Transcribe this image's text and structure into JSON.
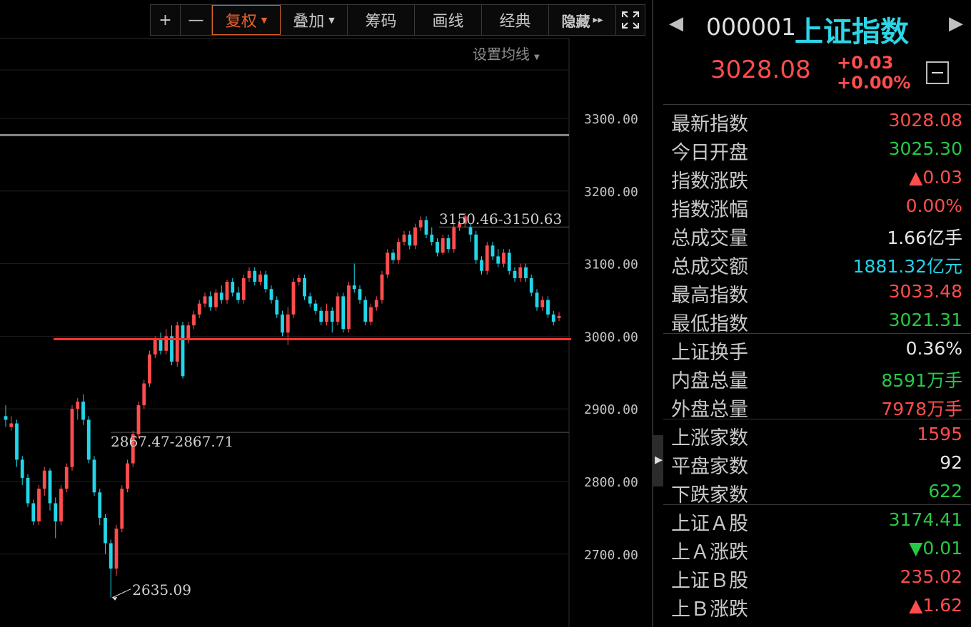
{
  "toolbar": {
    "zoom_in": "+",
    "zoom_out": "—",
    "rights": "复权",
    "overlay": "叠加",
    "chips": "筹码",
    "draw": "画线",
    "classic": "经典",
    "hide": "隐藏",
    "hide_arrows": "▸▸",
    "fullscreen_icon": "fullscreen-icon"
  },
  "ma_setting": "设置均线",
  "colors": {
    "up": "#ff4d4d",
    "down": "#21d6e8",
    "support": "#ff3333",
    "accent": "#e3622d",
    "name": "#2bd6e6"
  },
  "quote": {
    "code": "000001",
    "name": "上证指数",
    "price": "3028.08",
    "change": "+0.03",
    "change_pct": "+0.00%"
  },
  "stats": [
    {
      "label": "最新指数",
      "value": "3028.08",
      "color": "red"
    },
    {
      "label": "今日开盘",
      "value": "3025.30",
      "color": "green"
    },
    {
      "label": "指数涨跌",
      "value": "▲0.03",
      "color": "red"
    },
    {
      "label": "指数涨幅",
      "value": "0.00%",
      "color": "red"
    },
    {
      "label": "总成交量",
      "value": "1.66亿手",
      "color": "white"
    },
    {
      "label": "总成交额",
      "value": "1881.32亿元",
      "color": "cyan"
    },
    {
      "label": "最高指数",
      "value": "3033.48",
      "color": "red"
    },
    {
      "label": "最低指数",
      "value": "3021.31",
      "color": "green"
    },
    {
      "label": "上证换手",
      "value": "0.36%",
      "color": "white"
    },
    {
      "label": "内盘总量",
      "value": "8591万手",
      "color": "green"
    },
    {
      "label": "外盘总量",
      "value": "7978万手",
      "color": "red"
    },
    {
      "label": "上涨家数",
      "value": "1595",
      "color": "red"
    },
    {
      "label": "平盘家数",
      "value": "92",
      "color": "white"
    },
    {
      "label": "下跌家数",
      "value": "622",
      "color": "green"
    },
    {
      "label": "上证Ａ股",
      "value": "3174.41",
      "color": "green"
    },
    {
      "label": "上Ａ涨跌",
      "value": "▼0.01",
      "color": "green"
    },
    {
      "label": "上证Ｂ股",
      "value": "235.02",
      "color": "red"
    },
    {
      "label": "上Ｂ涨跌",
      "value": "▲1.62",
      "color": "red"
    }
  ],
  "chart_data": {
    "type": "candlestick",
    "y_ticks": [
      "3300.00",
      "3200.00",
      "3100.00",
      "3000.00",
      "2900.00",
      "2800.00",
      "2700.00"
    ],
    "ylim": [
      2625,
      3385
    ],
    "annotations": {
      "low": "2635.09",
      "range_low": "2867.47-2867.71",
      "range_high": "3150.46-3150.63"
    },
    "reference_lines": {
      "support": 2996,
      "grey_upper": 3277,
      "grey_lower": 2867.6,
      "grey_high": 3150.5
    },
    "candles": [
      [
        2890,
        2885,
        2905,
        2875
      ],
      [
        2875,
        2880,
        2890,
        2870
      ],
      [
        2880,
        2830,
        2885,
        2820
      ],
      [
        2830,
        2805,
        2835,
        2795
      ],
      [
        2805,
        2770,
        2810,
        2765
      ],
      [
        2770,
        2745,
        2775,
        2740
      ],
      [
        2745,
        2790,
        2795,
        2740
      ],
      [
        2790,
        2815,
        2820,
        2780
      ],
      [
        2815,
        2770,
        2818,
        2760
      ],
      [
        2770,
        2745,
        2778,
        2722
      ],
      [
        2745,
        2790,
        2795,
        2740
      ],
      [
        2790,
        2820,
        2825,
        2785
      ],
      [
        2820,
        2900,
        2905,
        2815
      ],
      [
        2900,
        2910,
        2915,
        2885
      ],
      [
        2910,
        2885,
        2920,
        2878
      ],
      [
        2885,
        2830,
        2890,
        2825
      ],
      [
        2830,
        2785,
        2835,
        2780
      ],
      [
        2785,
        2750,
        2790,
        2740
      ],
      [
        2750,
        2715,
        2755,
        2700
      ],
      [
        2715,
        2680,
        2720,
        2640
      ],
      [
        2680,
        2735,
        2740,
        2670
      ],
      [
        2735,
        2790,
        2795,
        2730
      ],
      [
        2790,
        2825,
        2830,
        2785
      ],
      [
        2825,
        2865,
        2870,
        2820
      ],
      [
        2865,
        2905,
        2910,
        2860
      ],
      [
        2905,
        2935,
        2940,
        2900
      ],
      [
        2935,
        2975,
        2980,
        2930
      ],
      [
        2975,
        2995,
        3000,
        2970
      ],
      [
        2995,
        2980,
        3005,
        2975
      ],
      [
        2980,
        3000,
        3010,
        2975
      ],
      [
        3000,
        2965,
        3015,
        2960
      ],
      [
        2965,
        3015,
        3020,
        2958
      ],
      [
        3015,
        2945,
        3020,
        2942
      ],
      [
        2995,
        3015,
        3020,
        2990
      ],
      [
        3015,
        3030,
        3035,
        3010
      ],
      [
        3030,
        3045,
        3050,
        3025
      ],
      [
        3045,
        3055,
        3060,
        3040
      ],
      [
        3055,
        3040,
        3062,
        3035
      ],
      [
        3040,
        3060,
        3065,
        3035
      ],
      [
        3060,
        3050,
        3070,
        3045
      ],
      [
        3050,
        3075,
        3078,
        3045
      ],
      [
        3075,
        3060,
        3080,
        3055
      ],
      [
        3060,
        3050,
        3068,
        3045
      ],
      [
        3050,
        3080,
        3085,
        3045
      ],
      [
        3080,
        3090,
        3095,
        3075
      ],
      [
        3090,
        3075,
        3095,
        3070
      ],
      [
        3075,
        3085,
        3090,
        3070
      ],
      [
        3085,
        3065,
        3090,
        3060
      ],
      [
        3065,
        3050,
        3070,
        3045
      ],
      [
        3050,
        3030,
        3055,
        3025
      ],
      [
        3030,
        3005,
        3035,
        3000
      ],
      [
        3005,
        3030,
        3040,
        2988
      ],
      [
        3030,
        3075,
        3080,
        3025
      ],
      [
        3075,
        3080,
        3085,
        3070
      ],
      [
        3080,
        3055,
        3085,
        3050
      ],
      [
        3055,
        3045,
        3060,
        3040
      ],
      [
        3045,
        3035,
        3050,
        3030
      ],
      [
        3035,
        3020,
        3040,
        3015
      ],
      [
        3020,
        3035,
        3045,
        3015
      ],
      [
        3035,
        3020,
        3040,
        3005
      ],
      [
        3020,
        3055,
        3060,
        3015
      ],
      [
        3055,
        3010,
        3060,
        3005
      ],
      [
        3010,
        3070,
        3075,
        3005
      ],
      [
        3070,
        3065,
        3100,
        3060
      ],
      [
        3065,
        3050,
        3070,
        3045
      ],
      [
        3050,
        3020,
        3055,
        3015
      ],
      [
        3020,
        3040,
        3045,
        3015
      ],
      [
        3040,
        3050,
        3055,
        3035
      ],
      [
        3050,
        3085,
        3090,
        3045
      ],
      [
        3085,
        3115,
        3120,
        3080
      ],
      [
        3115,
        3105,
        3120,
        3100
      ],
      [
        3105,
        3130,
        3135,
        3100
      ],
      [
        3130,
        3140,
        3145,
        3125
      ],
      [
        3140,
        3125,
        3145,
        3120
      ],
      [
        3125,
        3150,
        3155,
        3120
      ],
      [
        3150,
        3160,
        3165,
        3145
      ],
      [
        3160,
        3140,
        3165,
        3135
      ],
      [
        3140,
        3130,
        3150,
        3125
      ],
      [
        3130,
        3115,
        3135,
        3110
      ],
      [
        3115,
        3135,
        3140,
        3112
      ],
      [
        3135,
        3120,
        3140,
        3115
      ],
      [
        3120,
        3150,
        3155,
        3115
      ],
      [
        3150,
        3155,
        3160,
        3145
      ],
      [
        3155,
        3165,
        3170,
        3150
      ],
      [
        3150,
        3140,
        3155,
        3130
      ],
      [
        3140,
        3105,
        3145,
        3100
      ],
      [
        3105,
        3090,
        3110,
        3085
      ],
      [
        3090,
        3125,
        3130,
        3085
      ],
      [
        3125,
        3110,
        3130,
        3105
      ],
      [
        3110,
        3100,
        3120,
        3095
      ],
      [
        3100,
        3115,
        3120,
        3095
      ],
      [
        3115,
        3090,
        3120,
        3085
      ],
      [
        3090,
        3080,
        3095,
        3075
      ],
      [
        3080,
        3095,
        3100,
        3075
      ],
      [
        3095,
        3080,
        3100,
        3075
      ],
      [
        3080,
        3060,
        3085,
        3055
      ],
      [
        3060,
        3040,
        3065,
        3035
      ],
      [
        3040,
        3050,
        3055,
        3035
      ],
      [
        3050,
        3030,
        3055,
        3025
      ],
      [
        3030,
        3020,
        3035,
        3015
      ],
      [
        3025,
        3028,
        3033,
        3021
      ]
    ]
  }
}
